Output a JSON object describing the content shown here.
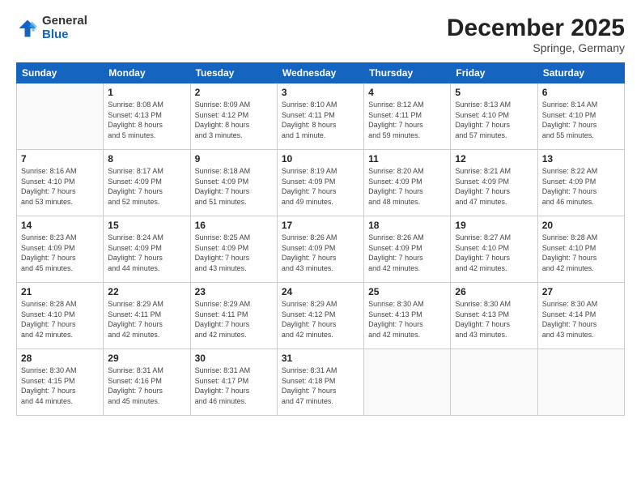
{
  "logo": {
    "general": "General",
    "blue": "Blue"
  },
  "title": "December 2025",
  "subtitle": "Springe, Germany",
  "headers": [
    "Sunday",
    "Monday",
    "Tuesday",
    "Wednesday",
    "Thursday",
    "Friday",
    "Saturday"
  ],
  "weeks": [
    [
      {
        "day": "",
        "info": ""
      },
      {
        "day": "1",
        "info": "Sunrise: 8:08 AM\nSunset: 4:13 PM\nDaylight: 8 hours\nand 5 minutes."
      },
      {
        "day": "2",
        "info": "Sunrise: 8:09 AM\nSunset: 4:12 PM\nDaylight: 8 hours\nand 3 minutes."
      },
      {
        "day": "3",
        "info": "Sunrise: 8:10 AM\nSunset: 4:11 PM\nDaylight: 8 hours\nand 1 minute."
      },
      {
        "day": "4",
        "info": "Sunrise: 8:12 AM\nSunset: 4:11 PM\nDaylight: 7 hours\nand 59 minutes."
      },
      {
        "day": "5",
        "info": "Sunrise: 8:13 AM\nSunset: 4:10 PM\nDaylight: 7 hours\nand 57 minutes."
      },
      {
        "day": "6",
        "info": "Sunrise: 8:14 AM\nSunset: 4:10 PM\nDaylight: 7 hours\nand 55 minutes."
      }
    ],
    [
      {
        "day": "7",
        "info": "Sunrise: 8:16 AM\nSunset: 4:10 PM\nDaylight: 7 hours\nand 53 minutes."
      },
      {
        "day": "8",
        "info": "Sunrise: 8:17 AM\nSunset: 4:09 PM\nDaylight: 7 hours\nand 52 minutes."
      },
      {
        "day": "9",
        "info": "Sunrise: 8:18 AM\nSunset: 4:09 PM\nDaylight: 7 hours\nand 51 minutes."
      },
      {
        "day": "10",
        "info": "Sunrise: 8:19 AM\nSunset: 4:09 PM\nDaylight: 7 hours\nand 49 minutes."
      },
      {
        "day": "11",
        "info": "Sunrise: 8:20 AM\nSunset: 4:09 PM\nDaylight: 7 hours\nand 48 minutes."
      },
      {
        "day": "12",
        "info": "Sunrise: 8:21 AM\nSunset: 4:09 PM\nDaylight: 7 hours\nand 47 minutes."
      },
      {
        "day": "13",
        "info": "Sunrise: 8:22 AM\nSunset: 4:09 PM\nDaylight: 7 hours\nand 46 minutes."
      }
    ],
    [
      {
        "day": "14",
        "info": "Sunrise: 8:23 AM\nSunset: 4:09 PM\nDaylight: 7 hours\nand 45 minutes."
      },
      {
        "day": "15",
        "info": "Sunrise: 8:24 AM\nSunset: 4:09 PM\nDaylight: 7 hours\nand 44 minutes."
      },
      {
        "day": "16",
        "info": "Sunrise: 8:25 AM\nSunset: 4:09 PM\nDaylight: 7 hours\nand 43 minutes."
      },
      {
        "day": "17",
        "info": "Sunrise: 8:26 AM\nSunset: 4:09 PM\nDaylight: 7 hours\nand 43 minutes."
      },
      {
        "day": "18",
        "info": "Sunrise: 8:26 AM\nSunset: 4:09 PM\nDaylight: 7 hours\nand 42 minutes."
      },
      {
        "day": "19",
        "info": "Sunrise: 8:27 AM\nSunset: 4:10 PM\nDaylight: 7 hours\nand 42 minutes."
      },
      {
        "day": "20",
        "info": "Sunrise: 8:28 AM\nSunset: 4:10 PM\nDaylight: 7 hours\nand 42 minutes."
      }
    ],
    [
      {
        "day": "21",
        "info": "Sunrise: 8:28 AM\nSunset: 4:10 PM\nDaylight: 7 hours\nand 42 minutes."
      },
      {
        "day": "22",
        "info": "Sunrise: 8:29 AM\nSunset: 4:11 PM\nDaylight: 7 hours\nand 42 minutes."
      },
      {
        "day": "23",
        "info": "Sunrise: 8:29 AM\nSunset: 4:11 PM\nDaylight: 7 hours\nand 42 minutes."
      },
      {
        "day": "24",
        "info": "Sunrise: 8:29 AM\nSunset: 4:12 PM\nDaylight: 7 hours\nand 42 minutes."
      },
      {
        "day": "25",
        "info": "Sunrise: 8:30 AM\nSunset: 4:13 PM\nDaylight: 7 hours\nand 42 minutes."
      },
      {
        "day": "26",
        "info": "Sunrise: 8:30 AM\nSunset: 4:13 PM\nDaylight: 7 hours\nand 43 minutes."
      },
      {
        "day": "27",
        "info": "Sunrise: 8:30 AM\nSunset: 4:14 PM\nDaylight: 7 hours\nand 43 minutes."
      }
    ],
    [
      {
        "day": "28",
        "info": "Sunrise: 8:30 AM\nSunset: 4:15 PM\nDaylight: 7 hours\nand 44 minutes."
      },
      {
        "day": "29",
        "info": "Sunrise: 8:31 AM\nSunset: 4:16 PM\nDaylight: 7 hours\nand 45 minutes."
      },
      {
        "day": "30",
        "info": "Sunrise: 8:31 AM\nSunset: 4:17 PM\nDaylight: 7 hours\nand 46 minutes."
      },
      {
        "day": "31",
        "info": "Sunrise: 8:31 AM\nSunset: 4:18 PM\nDaylight: 7 hours\nand 47 minutes."
      },
      {
        "day": "",
        "info": ""
      },
      {
        "day": "",
        "info": ""
      },
      {
        "day": "",
        "info": ""
      }
    ]
  ]
}
